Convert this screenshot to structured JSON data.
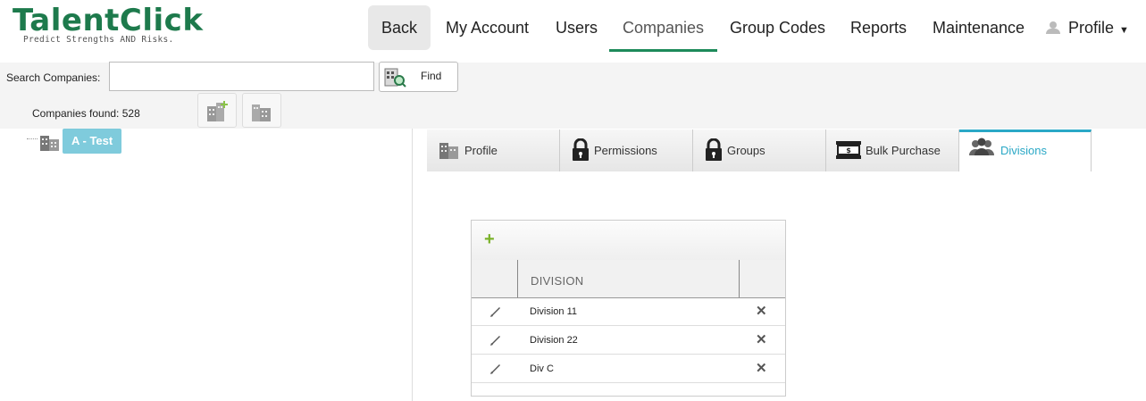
{
  "header": {
    "logo_title": "TalentClick",
    "logo_tagline": "Predict Strengths AND Risks.",
    "nav": {
      "back": "Back",
      "my_account": "My Account",
      "users": "Users",
      "companies": "Companies",
      "group_codes": "Group Codes",
      "reports": "Reports",
      "maintenance": "Maintenance",
      "profile": "Profile"
    },
    "accent_color": "#1d8a5a"
  },
  "search": {
    "label": "Search Companies:",
    "value": "",
    "find_label": "Find",
    "found_text": "Companies found: 528"
  },
  "tree": {
    "node_label": "A - Test",
    "node_color": "#7fcbdc"
  },
  "tabs": [
    {
      "label": "Profile",
      "icon": "building-icon"
    },
    {
      "label": "Permissions",
      "icon": "lock-icon"
    },
    {
      "label": "Groups",
      "icon": "lock-icon"
    },
    {
      "label": "Bulk Purchase",
      "icon": "money-stack-icon"
    },
    {
      "label": "Divisions",
      "icon": "people-icon",
      "active": true
    }
  ],
  "divisions": {
    "column_header": "DIVISION",
    "rows": [
      "Division 11",
      "Division 22",
      "Div C"
    ]
  }
}
